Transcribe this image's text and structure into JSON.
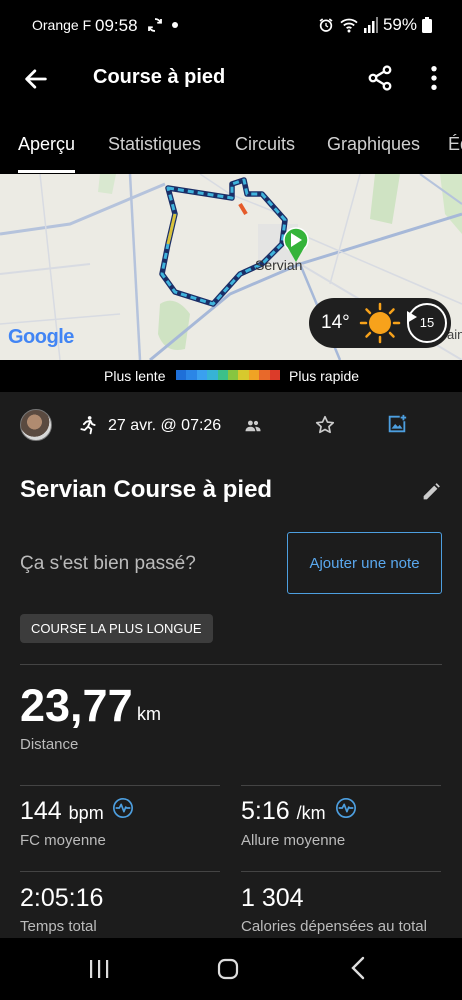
{
  "status_bar": {
    "carrier": "Orange F",
    "time": "09:58",
    "battery": "59%",
    "icons": [
      "sync-icon",
      "alarm-icon",
      "wifi-icon",
      "signal-icon",
      "battery-icon"
    ]
  },
  "header": {
    "title": "Course à pied",
    "icons": [
      "back-arrow-icon",
      "share-icon",
      "more-vert-icon"
    ]
  },
  "tabs": [
    {
      "label": "Aperçu",
      "active": true
    },
    {
      "label": "Statistiques",
      "active": false
    },
    {
      "label": "Circuits",
      "active": false
    },
    {
      "label": "Graphiques",
      "active": false
    },
    {
      "label": "Éq",
      "active": false
    }
  ],
  "map": {
    "logo": "Google",
    "town_label": "Servian",
    "edge_label": "ain",
    "weather": {
      "temperature": "14°",
      "wind": "15",
      "icon": "sun-icon"
    }
  },
  "pace_legend": {
    "slow_label": "Plus lente",
    "fast_label": "Plus rapide",
    "colors": [
      "#1e6fd8",
      "#2b86e6",
      "#3aa0ef",
      "#36b3d6",
      "#3cc089",
      "#88c540",
      "#d7c92d",
      "#f0a324",
      "#e8692a",
      "#dc3b29"
    ]
  },
  "activity": {
    "date": "27 avr. @ 07:26",
    "title": "Servian Course à pied",
    "question": "Ça s'est bien passé?",
    "add_note_label": "Ajouter une note",
    "badge": "COURSE LA PLUS LONGUE",
    "accent_color": "#4d9fe0"
  },
  "stats": {
    "distance": {
      "value": "23,77",
      "unit": "km",
      "label": "Distance"
    },
    "heart_rate": {
      "value": "144",
      "unit": "bpm",
      "label": "FC moyenne"
    },
    "pace": {
      "value": "5:16",
      "unit": "/km",
      "label": "Allure moyenne"
    },
    "total_time": {
      "value": "2:05:16",
      "label": "Temps total"
    },
    "calories": {
      "value": "1 304",
      "label": "Calories dépensées au total"
    }
  },
  "nav_bar": {
    "icons": [
      "recent-apps-icon",
      "home-icon",
      "back-icon"
    ]
  }
}
